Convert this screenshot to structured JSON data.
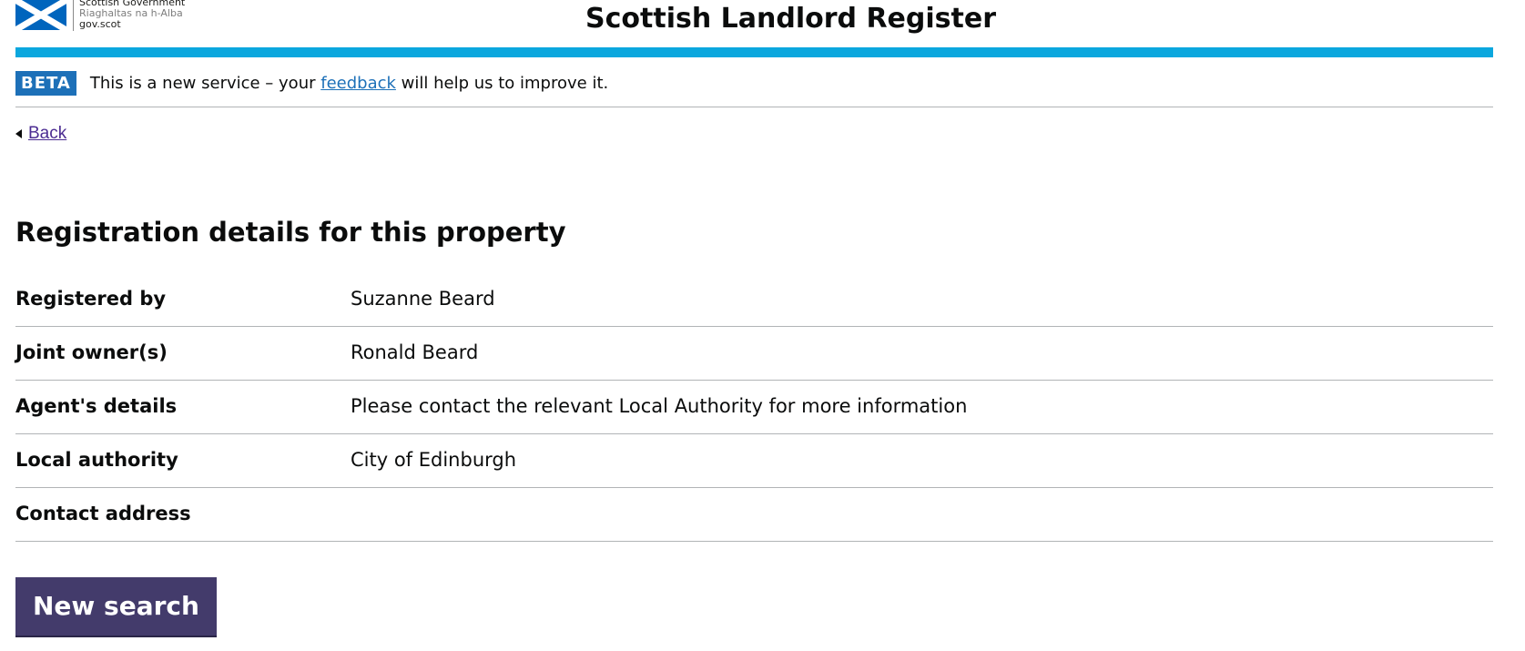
{
  "header": {
    "logo": {
      "line1": "Scottish Government",
      "line2": "Riaghaltas na h-Alba",
      "line3": "gov.scot"
    },
    "title": "Scottish Landlord Register"
  },
  "colors": {
    "accent_bar": "#0ba7de",
    "beta_tag": "#1d70b8",
    "link": "#1d70b8",
    "back_link": "#4c2c92",
    "button": "#433b6b"
  },
  "banner": {
    "tag": "BETA",
    "text_before": "This is a new service – your ",
    "link": "feedback",
    "text_after": " will help us to improve it."
  },
  "back": {
    "icon": "triangle-left-icon",
    "label": "Back"
  },
  "page": {
    "heading": "Registration details for this property"
  },
  "details": [
    {
      "key": "Registered by",
      "value": "Suzanne Beard"
    },
    {
      "key": "Joint owner(s)",
      "value": "Ronald Beard"
    },
    {
      "key": "Agent's details",
      "value": "Please contact the relevant Local Authority for more information"
    },
    {
      "key": "Local authority",
      "value": "City of Edinburgh"
    },
    {
      "key": "Contact address",
      "value": ""
    }
  ],
  "actions": {
    "new_search": "New search"
  }
}
